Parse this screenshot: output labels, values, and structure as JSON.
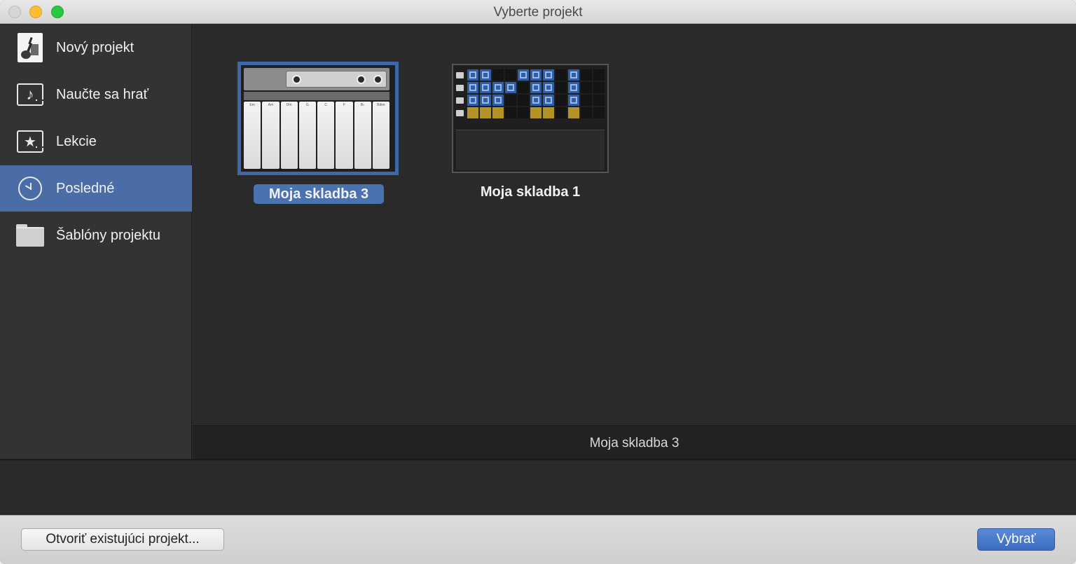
{
  "window": {
    "title": "Vyberte projekt"
  },
  "sidebar": {
    "items": [
      {
        "label": "Nový projekt",
        "icon": "new-project-icon"
      },
      {
        "label": "Naučte sa hrať",
        "icon": "learn-to-play-icon"
      },
      {
        "label": "Lekcie",
        "icon": "lessons-star-icon"
      },
      {
        "label": "Posledné",
        "icon": "clock-icon",
        "selected": true
      },
      {
        "label": "Šablóny projektu",
        "icon": "folder-icon"
      }
    ]
  },
  "projects": [
    {
      "name": "Moja skladba 3",
      "selected": true,
      "thumbnail": "keyboard-instrument"
    },
    {
      "name": "Moja skladba 1",
      "selected": false,
      "thumbnail": "live-loops-grid"
    }
  ],
  "keyboard_keys": [
    "Em",
    "Am",
    "Dm",
    "G",
    "C",
    "F",
    "B♭",
    "Bdim"
  ],
  "selected_filename": "Moja skladba 3",
  "buttons": {
    "open_existing": "Otvoriť existujúci projekt...",
    "choose": "Vybrať"
  },
  "colors": {
    "selection_blue": "#4a6da8",
    "primary_button": "#3a6cc0"
  }
}
